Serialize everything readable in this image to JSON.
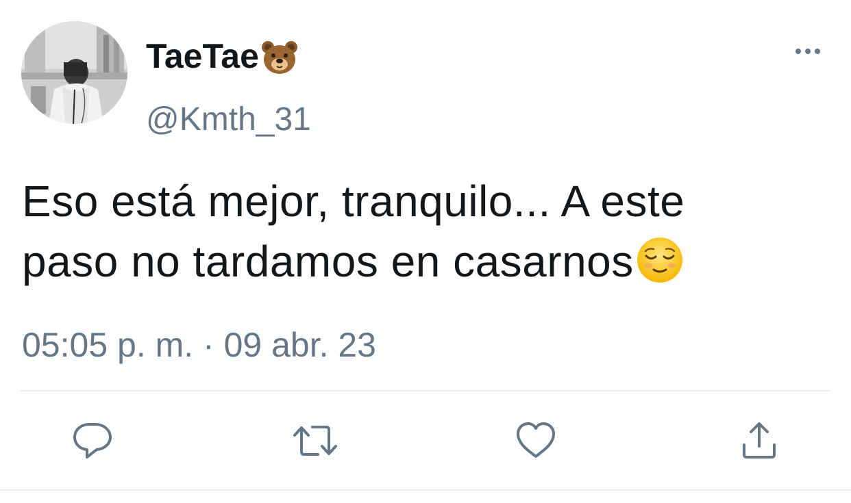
{
  "author": {
    "display_name": "TaeTae",
    "display_name_emoji": "bear-face-icon",
    "handle": "@Kmth_31",
    "avatar": "profile-photo-grayscale"
  },
  "tweet": {
    "text_line_1": "Eso está mejor, tranquilo... A este",
    "text_line_2": "paso no tardamos en casarnos",
    "text_emoji": "relieved-face-icon",
    "timestamp": "05:05 p. m. · 09 abr. 23"
  },
  "actions": [
    {
      "name": "reply",
      "icon": "reply-icon"
    },
    {
      "name": "retweet",
      "icon": "retweet-icon"
    },
    {
      "name": "like",
      "icon": "heart-icon"
    },
    {
      "name": "share",
      "icon": "share-icon"
    }
  ],
  "colors": {
    "text_primary": "#14171a",
    "text_secondary": "#657786",
    "icon": "#657786",
    "divider": "#e6ecf0",
    "background": "#ffffff"
  }
}
